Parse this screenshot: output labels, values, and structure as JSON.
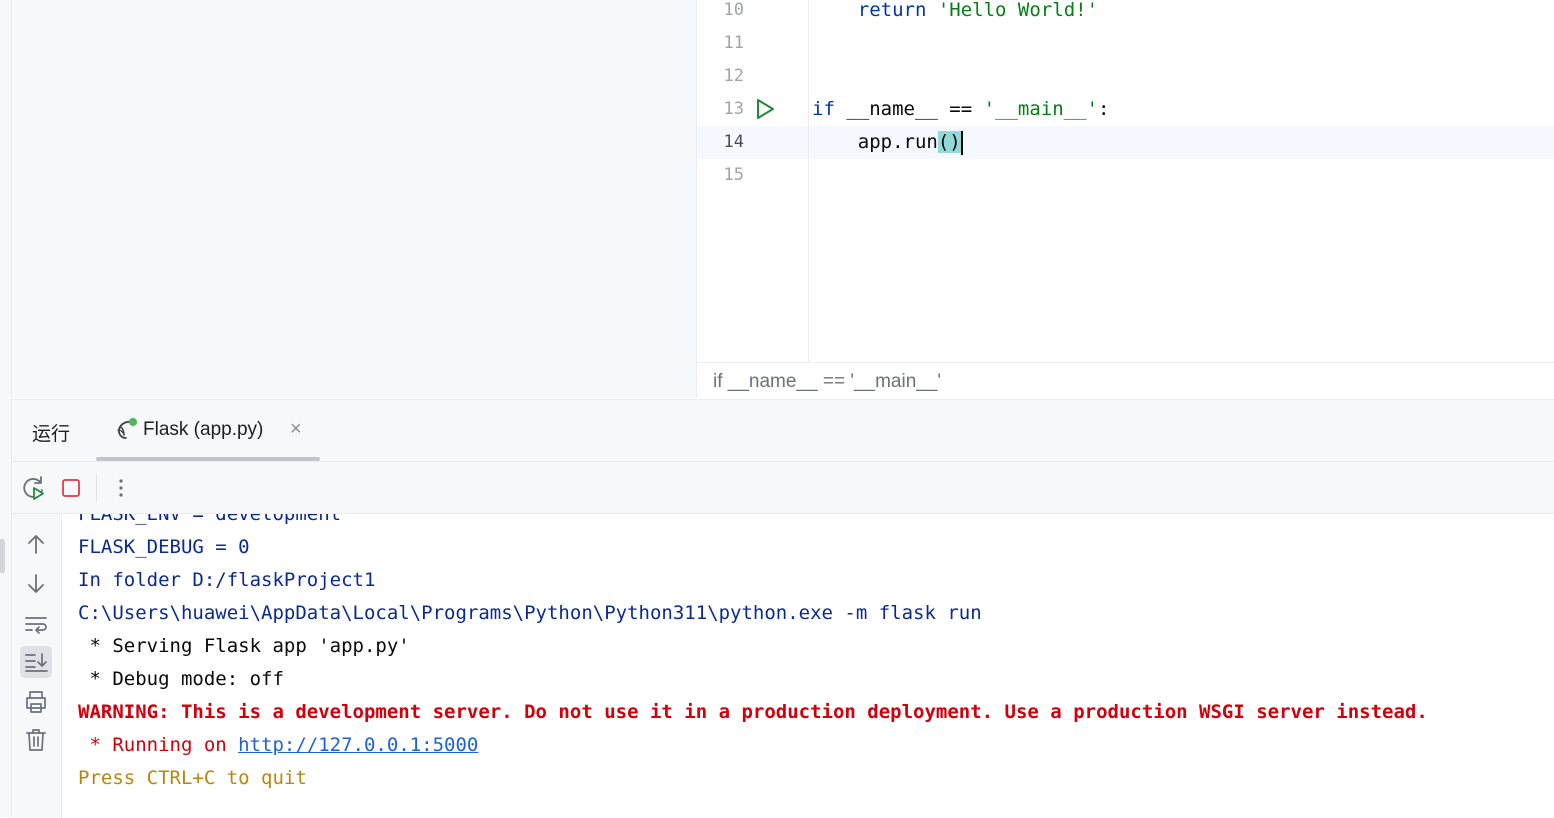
{
  "editor": {
    "lines": [
      {
        "num": "10",
        "text": ""
      },
      {
        "num": "11",
        "text": ""
      },
      {
        "num": "12",
        "text": ""
      },
      {
        "num": "13",
        "text": ""
      },
      {
        "num": "14",
        "text": ""
      },
      {
        "num": "15",
        "text": ""
      }
    ],
    "code": {
      "line10_kw": "return",
      "line10_str": "'Hello World!'",
      "line13_kw": "if",
      "line13_mid": " __name__ == ",
      "line13_str": "'__main__'",
      "line13_end": ":",
      "line14_text": "app.run",
      "line14_bracket": "()"
    },
    "current_line": "14",
    "breadcrumb": "if __name__ == '__main__'"
  },
  "run_window": {
    "title": "运行",
    "tab_label": "Flask (app.py)",
    "tab_close": "×",
    "icons": {
      "tab": "flask-run-icon",
      "rerun": "rerun-icon",
      "stop": "stop-icon",
      "more": "more-vertical-icon",
      "up": "arrow-up-icon",
      "down": "arrow-down-icon",
      "wrap": "soft-wrap-icon",
      "scroll_end": "scroll-to-end-icon",
      "print": "print-icon",
      "clear": "trash-icon"
    }
  },
  "console": {
    "lines": [
      {
        "text": "FLASK_ENV = development",
        "style": "blue"
      },
      {
        "text": "FLASK_DEBUG = 0",
        "style": "blue"
      },
      {
        "text": "In folder D:/flaskProject1",
        "style": "blue"
      },
      {
        "text": "C:\\Users\\huawei\\AppData\\Local\\Programs\\Python\\Python311\\python.exe -m flask run",
        "style": "blue"
      },
      {
        "text": " * Serving Flask app 'app.py'",
        "style": "black"
      },
      {
        "text": " * Debug mode: off",
        "style": "black"
      },
      {
        "text": "WARNING: This is a development server. Do not use it in a production deployment. Use a production WSGI server instead.",
        "style": "red"
      },
      {
        "text": " * Running on ",
        "style": "red"
      },
      {
        "text": "Press CTRL+C to quit",
        "style": "yellow"
      }
    ],
    "running_link": "http://127.0.0.1:5000"
  },
  "colors": {
    "keyword": "#0033b3",
    "string": "#067d17",
    "console_blue": "#0b2a8f",
    "warning_red": "#d1000c",
    "quit_yellow": "#b8860b",
    "link": "#1f62d6"
  }
}
